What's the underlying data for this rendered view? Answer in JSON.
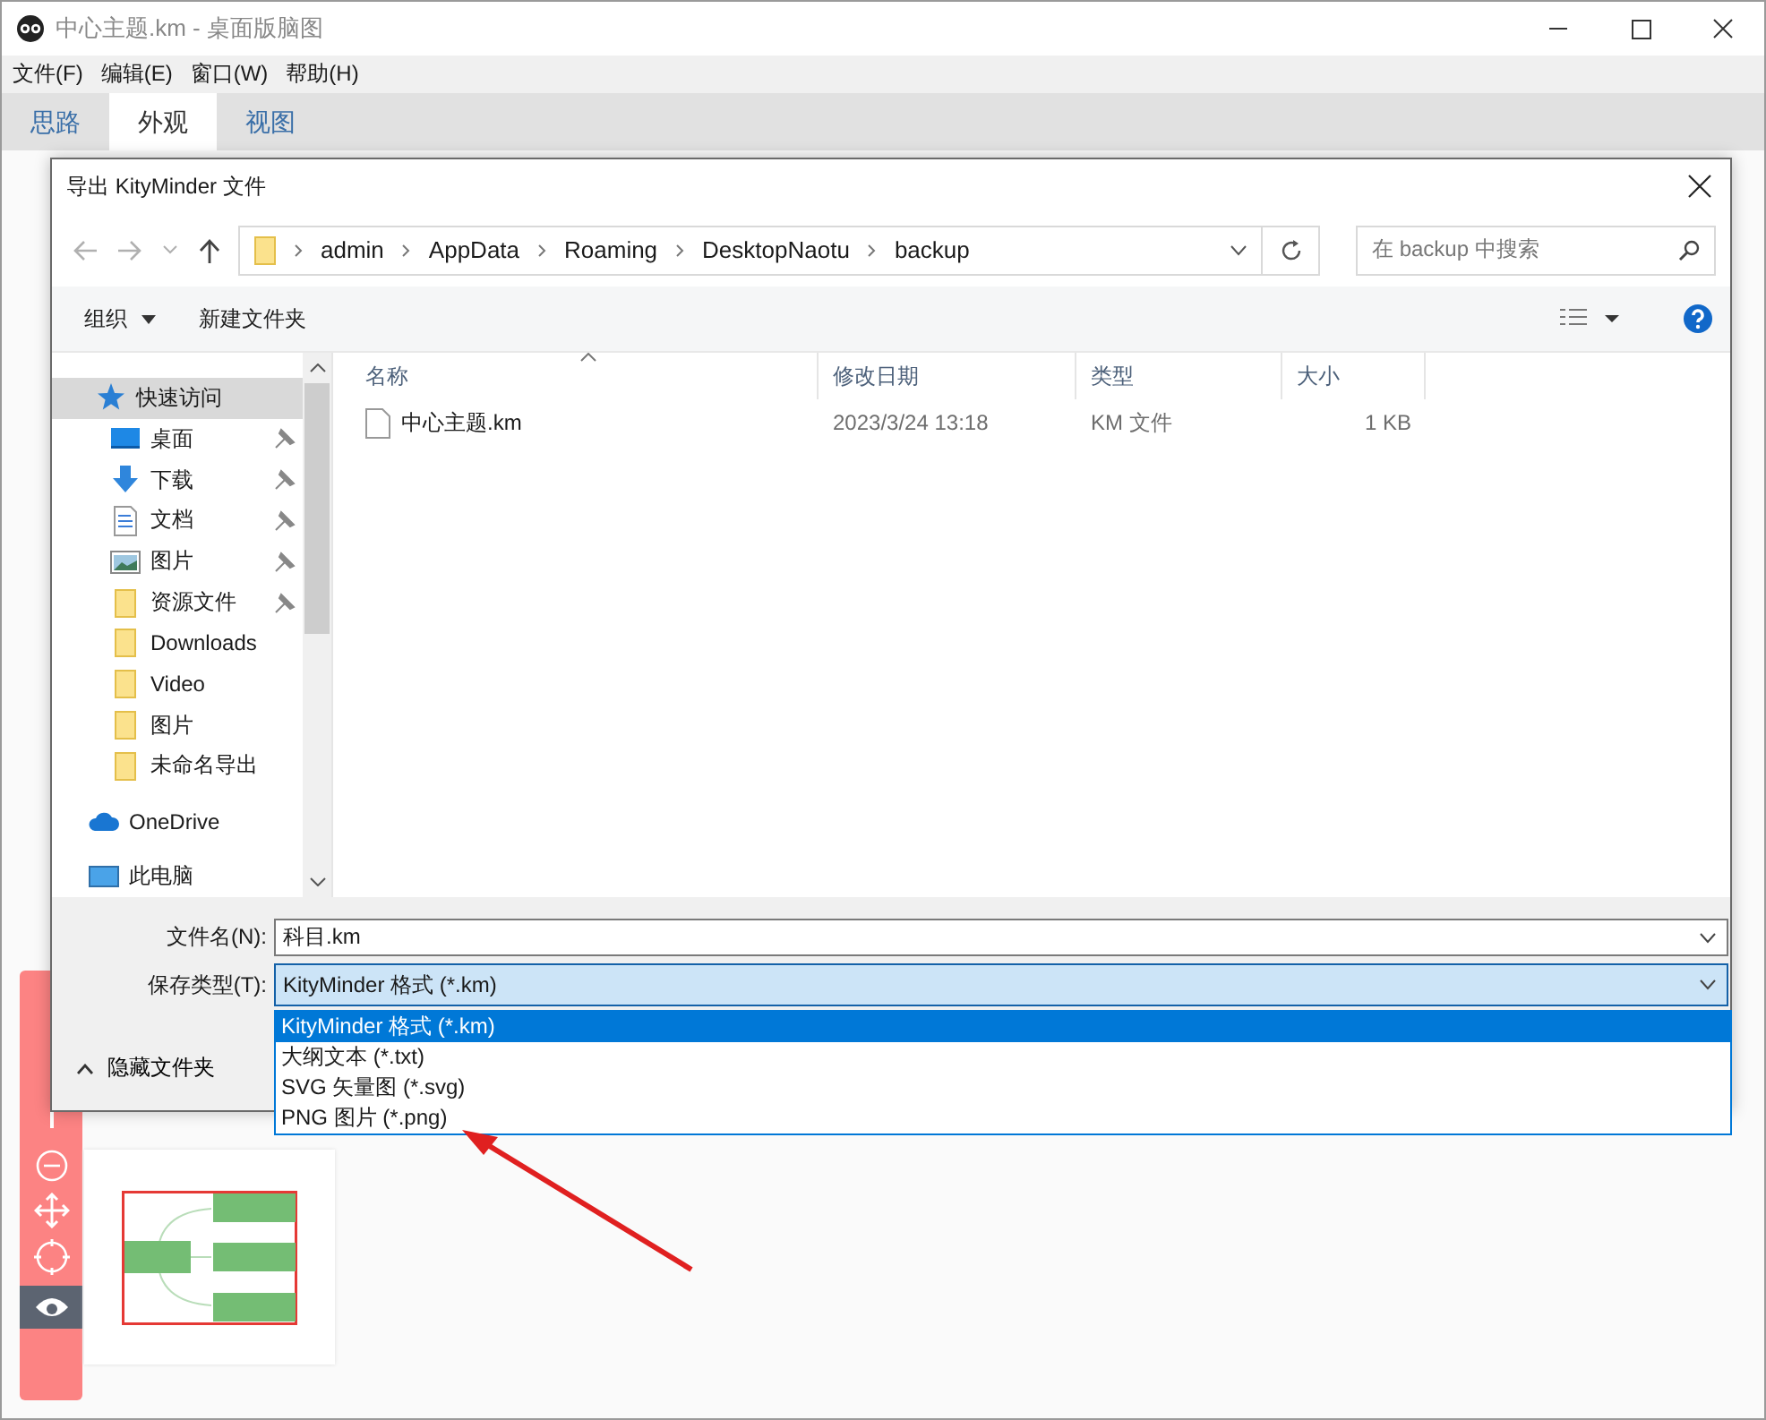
{
  "app": {
    "title": "中心主题.km - 桌面版脑图",
    "menu": [
      "文件(F)",
      "编辑(E)",
      "窗口(W)",
      "帮助(H)"
    ],
    "tabs": [
      {
        "label": "思路",
        "selected": false
      },
      {
        "label": "外观",
        "selected": true
      },
      {
        "label": "视图",
        "selected": false
      }
    ]
  },
  "dialog": {
    "title": "导出 KityMinder 文件",
    "breadcrumb": [
      "admin",
      "AppData",
      "Roaming",
      "DesktopNaotu",
      "backup"
    ],
    "search": {
      "placeholder": "在 backup 中搜索"
    },
    "toolbar": {
      "organize": "组织",
      "new_folder": "新建文件夹"
    },
    "sidebar": [
      {
        "label": "快速访问",
        "kind": "star",
        "pinned": false,
        "selected": true
      },
      {
        "label": "桌面",
        "kind": "desktop",
        "pinned": true,
        "selected": false
      },
      {
        "label": "下载",
        "kind": "download",
        "pinned": true,
        "selected": false
      },
      {
        "label": "文档",
        "kind": "document",
        "pinned": true,
        "selected": false
      },
      {
        "label": "图片",
        "kind": "picture",
        "pinned": true,
        "selected": false
      },
      {
        "label": "资源文件",
        "kind": "folder",
        "pinned": true,
        "selected": false
      },
      {
        "label": "Downloads",
        "kind": "folder",
        "pinned": false,
        "selected": false
      },
      {
        "label": "Video",
        "kind": "folder",
        "pinned": false,
        "selected": false
      },
      {
        "label": "图片",
        "kind": "folder",
        "pinned": false,
        "selected": false
      },
      {
        "label": "未命名导出",
        "kind": "folder",
        "pinned": false,
        "selected": false
      },
      {
        "label": "OneDrive",
        "kind": "cloud",
        "pinned": false,
        "selected": false
      },
      {
        "label": "此电脑",
        "kind": "computer",
        "pinned": false,
        "selected": false
      }
    ],
    "columns": [
      "名称",
      "修改日期",
      "类型",
      "大小"
    ],
    "files": [
      {
        "name": "中心主题.km",
        "date": "2023/3/24 13:18",
        "type": "KM 文件",
        "size": "1 KB"
      }
    ],
    "filename": {
      "label": "文件名(N):",
      "value": "科目.km"
    },
    "filetype": {
      "label": "保存类型(T):",
      "value": "KityMinder 格式 (*.km)"
    },
    "options": [
      {
        "label": "KityMinder 格式 (*.km)",
        "selected": true
      },
      {
        "label": "大纲文本 (*.txt)",
        "selected": false
      },
      {
        "label": "SVG 矢量图 (*.svg)",
        "selected": false
      },
      {
        "label": "PNG 图片 (*.png)",
        "selected": false
      }
    ],
    "hide_folders": "隐藏文件夹"
  }
}
